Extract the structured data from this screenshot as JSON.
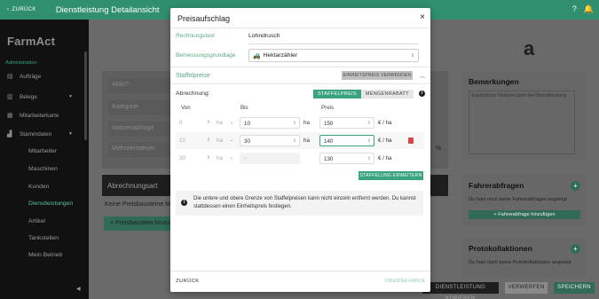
{
  "topbar": {
    "back": "ZURÜCK",
    "title": "Dienstleistung Detailansicht",
    "help": "?",
    "bell": "🔔"
  },
  "sidebar": {
    "logo": "FarmAct",
    "section": "Administration",
    "items": [
      {
        "label": "Aufträge",
        "icon": "clipboard-icon"
      },
      {
        "label": "Belege",
        "icon": "document-icon"
      },
      {
        "label": "Mitarbeiterkarte",
        "icon": "map-icon"
      },
      {
        "label": "Stammdaten",
        "icon": "chart-icon"
      }
    ],
    "subitems": [
      "Mitarbeiter",
      "Maschinen",
      "Kunden",
      "Dienstleistungen",
      "Artikel",
      "Tankstellen",
      "Mein Betrieb"
    ],
    "active": "Dienstleistungen"
  },
  "background": {
    "heading_fragment": "a",
    "fields": [
      "Aktiv?",
      "Kategorie",
      "Notizenabfrage",
      "Mehrwertsteuer"
    ],
    "percent": "%",
    "billing_type": "Abrechnungsart",
    "no_price_components": "Keine Preisbausteine M",
    "add_price_component": "+ Preisbaustein hinzu",
    "remarks_title": "Bemerkungen",
    "remarks_placeholder": "Zusätzliche Notizen über die Dienstleistung",
    "driver_queries_title": "Fahrerabfragen",
    "driver_queries_empty": "Du hast noch keine Fahrerabfragen angelegt",
    "driver_queries_add": "+ Fahrerabfrage hinzufügen",
    "protocols_title": "Protokollaktionen",
    "protocols_empty": "Du hast noch keine Protokollaktionen angelegt",
    "buttons": {
      "copy": "DIENSTLEISTUNG KOPIEREN",
      "discard": "VERWERFEN",
      "save": "SPEICHERN"
    }
  },
  "modal": {
    "title": "Preisaufschlag",
    "close": "×",
    "invoice_text_label": "Rechnungstext",
    "invoice_text_value": "Lohndrusch",
    "basis_label": "Bemessungsgrundlage",
    "basis_value": "Hektarzähler",
    "tiered_label": "Staffelpreise",
    "unit_price_button": "EINHEITSPREIS VERWENDEN",
    "billing_label": "Abrechnung:",
    "toggle": {
      "on": "STAFFELPREIS",
      "off": "MENGENRABATT"
    },
    "columns": {
      "from": "Von",
      "to": "Bis",
      "price": "Preis"
    },
    "rows": [
      {
        "from": "0",
        "to": "10",
        "price": "150",
        "unit": "ha",
        "price_unit": "€ / ha"
      },
      {
        "from": "10",
        "to": "30",
        "price": "140",
        "unit": "ha",
        "price_unit": "€ / ha"
      },
      {
        "from": "30",
        "to": "–",
        "price": "130",
        "unit": "ha",
        "price_unit": "€ / ha"
      }
    ],
    "extend_button": "STAFFELUNG ERWEITERN",
    "info_text": "Die untere und obere Grenze von Staffelpreisen kann nicht einzeln entfernt werden. Du kannst stattdessen einen Einheitspreis festlegen.",
    "footer": {
      "back": "ZURÜCK",
      "apply": "ÜBERNEHMEN"
    }
  },
  "colors": {
    "accent": "#3aa37f",
    "topbar": "#2f8f6e",
    "sidebar": "#111111",
    "danger": "#d04848"
  }
}
